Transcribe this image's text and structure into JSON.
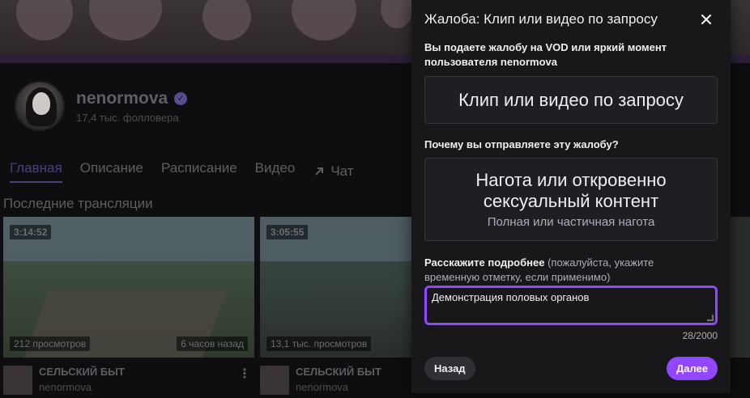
{
  "channel": {
    "name": "nenormova",
    "followers": "17,4 тыс. фолловера",
    "tabs": [
      "Главная",
      "Описание",
      "Расписание",
      "Видео",
      "Чат"
    ],
    "section_title": "Последние трансляции"
  },
  "vods": [
    {
      "duration": "3:14:52",
      "views": "212 просмотров",
      "ago": "6 часов назад",
      "title": "СЕЛЬСКИЙ БЫТ",
      "channel": "nenormova"
    },
    {
      "duration": "3:05:55",
      "views": "13,1 тыс. просмотров",
      "title": "СЕЛЬСКИЙ БЫТ",
      "channel": "nenormova"
    }
  ],
  "dialog": {
    "title": "Жалоба: Клип или видео по запросу",
    "report_target_label": "Вы подаете жалобу на VOD или яркий момент пользователя nenormova",
    "report_target_value": "Клип или видео по запросу",
    "reason_label": "Почему вы отправляете эту жалобу?",
    "reason_title": "Нагота или откровенно сексуальный контент",
    "reason_subtitle": "Полная или частичная нагота",
    "details_label_bold": "Расскажите подробнее",
    "details_label_light": "(пожалуйста, укажите временную отметку, если применимо)",
    "details_value": "Демонстрация половых органов",
    "counter": "28/2000",
    "back_label": "Назад",
    "next_label": "Далее"
  },
  "colors": {
    "accent": "#9147ff",
    "dialog_bg": "#18181b",
    "page_bg": "#0e0e10"
  }
}
